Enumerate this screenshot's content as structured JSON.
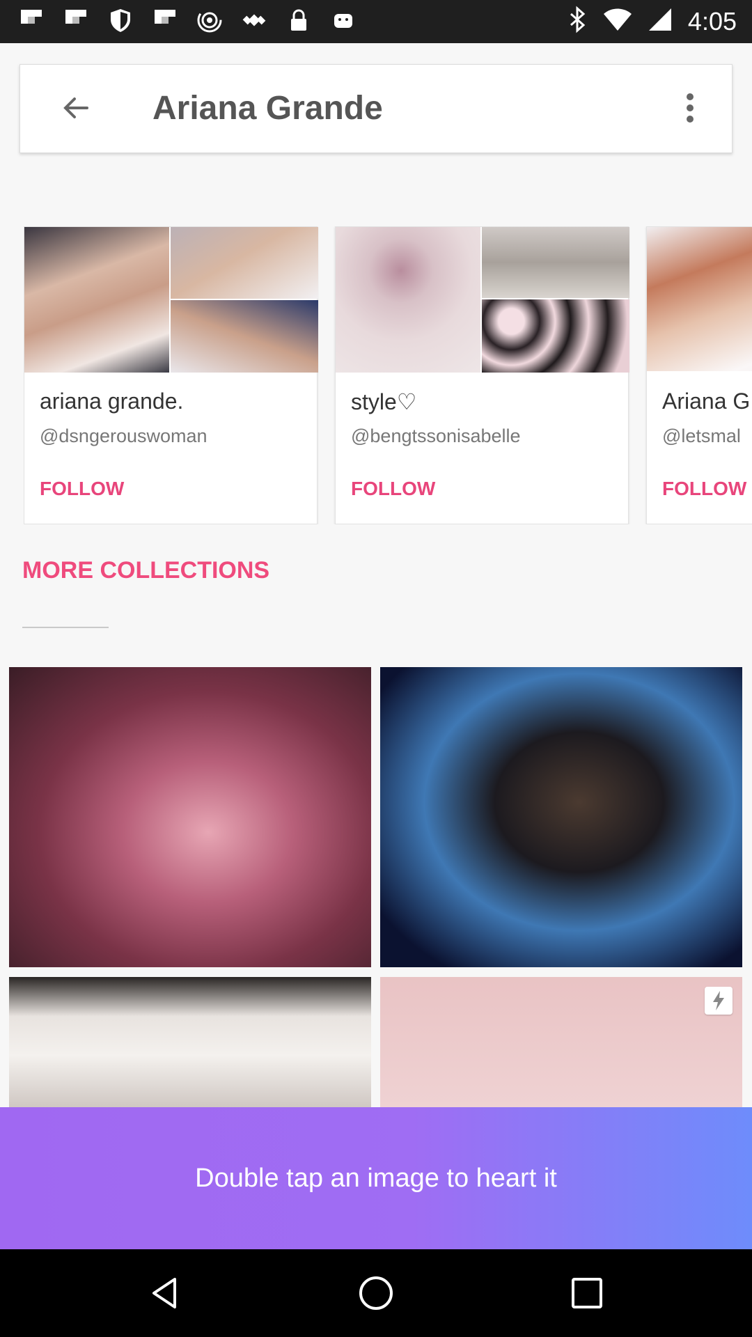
{
  "status_bar": {
    "time": "4:05",
    "left_icons": [
      "flipboard-icon",
      "flipboard-icon",
      "shield-icon",
      "flipboard-icon",
      "hotspot-icon",
      "fake-gps-icon",
      "lock-icon",
      "android-icon"
    ],
    "right_icons": [
      "bluetooth-icon",
      "wifi-icon",
      "signal-icon"
    ]
  },
  "app_bar": {
    "title": "Ariana Grande",
    "back_icon": "arrow-left-icon",
    "menu_icon": "more-vert-icon"
  },
  "collections": [
    {
      "name": "ariana grande.",
      "handle": "@dsngerouswoman",
      "follow_label": "FOLLOW"
    },
    {
      "name": "style♡",
      "handle": "@bengtssonisabelle",
      "follow_label": "FOLLOW"
    },
    {
      "name": "Ariana G",
      "handle": "@letsmal",
      "follow_label": "FOLLOW"
    }
  ],
  "section": {
    "heading": "MORE COLLECTIONS"
  },
  "photo_badge_icon": "lightning-icon",
  "hint": {
    "text": "Double tap an image to heart it"
  },
  "nav": {
    "icons": [
      "back-triangle-icon",
      "home-circle-icon",
      "recents-square-icon"
    ]
  },
  "colors": {
    "accent": "#ef4b7d",
    "banner_start": "#a068f2",
    "banner_end": "#6e8cfb"
  }
}
